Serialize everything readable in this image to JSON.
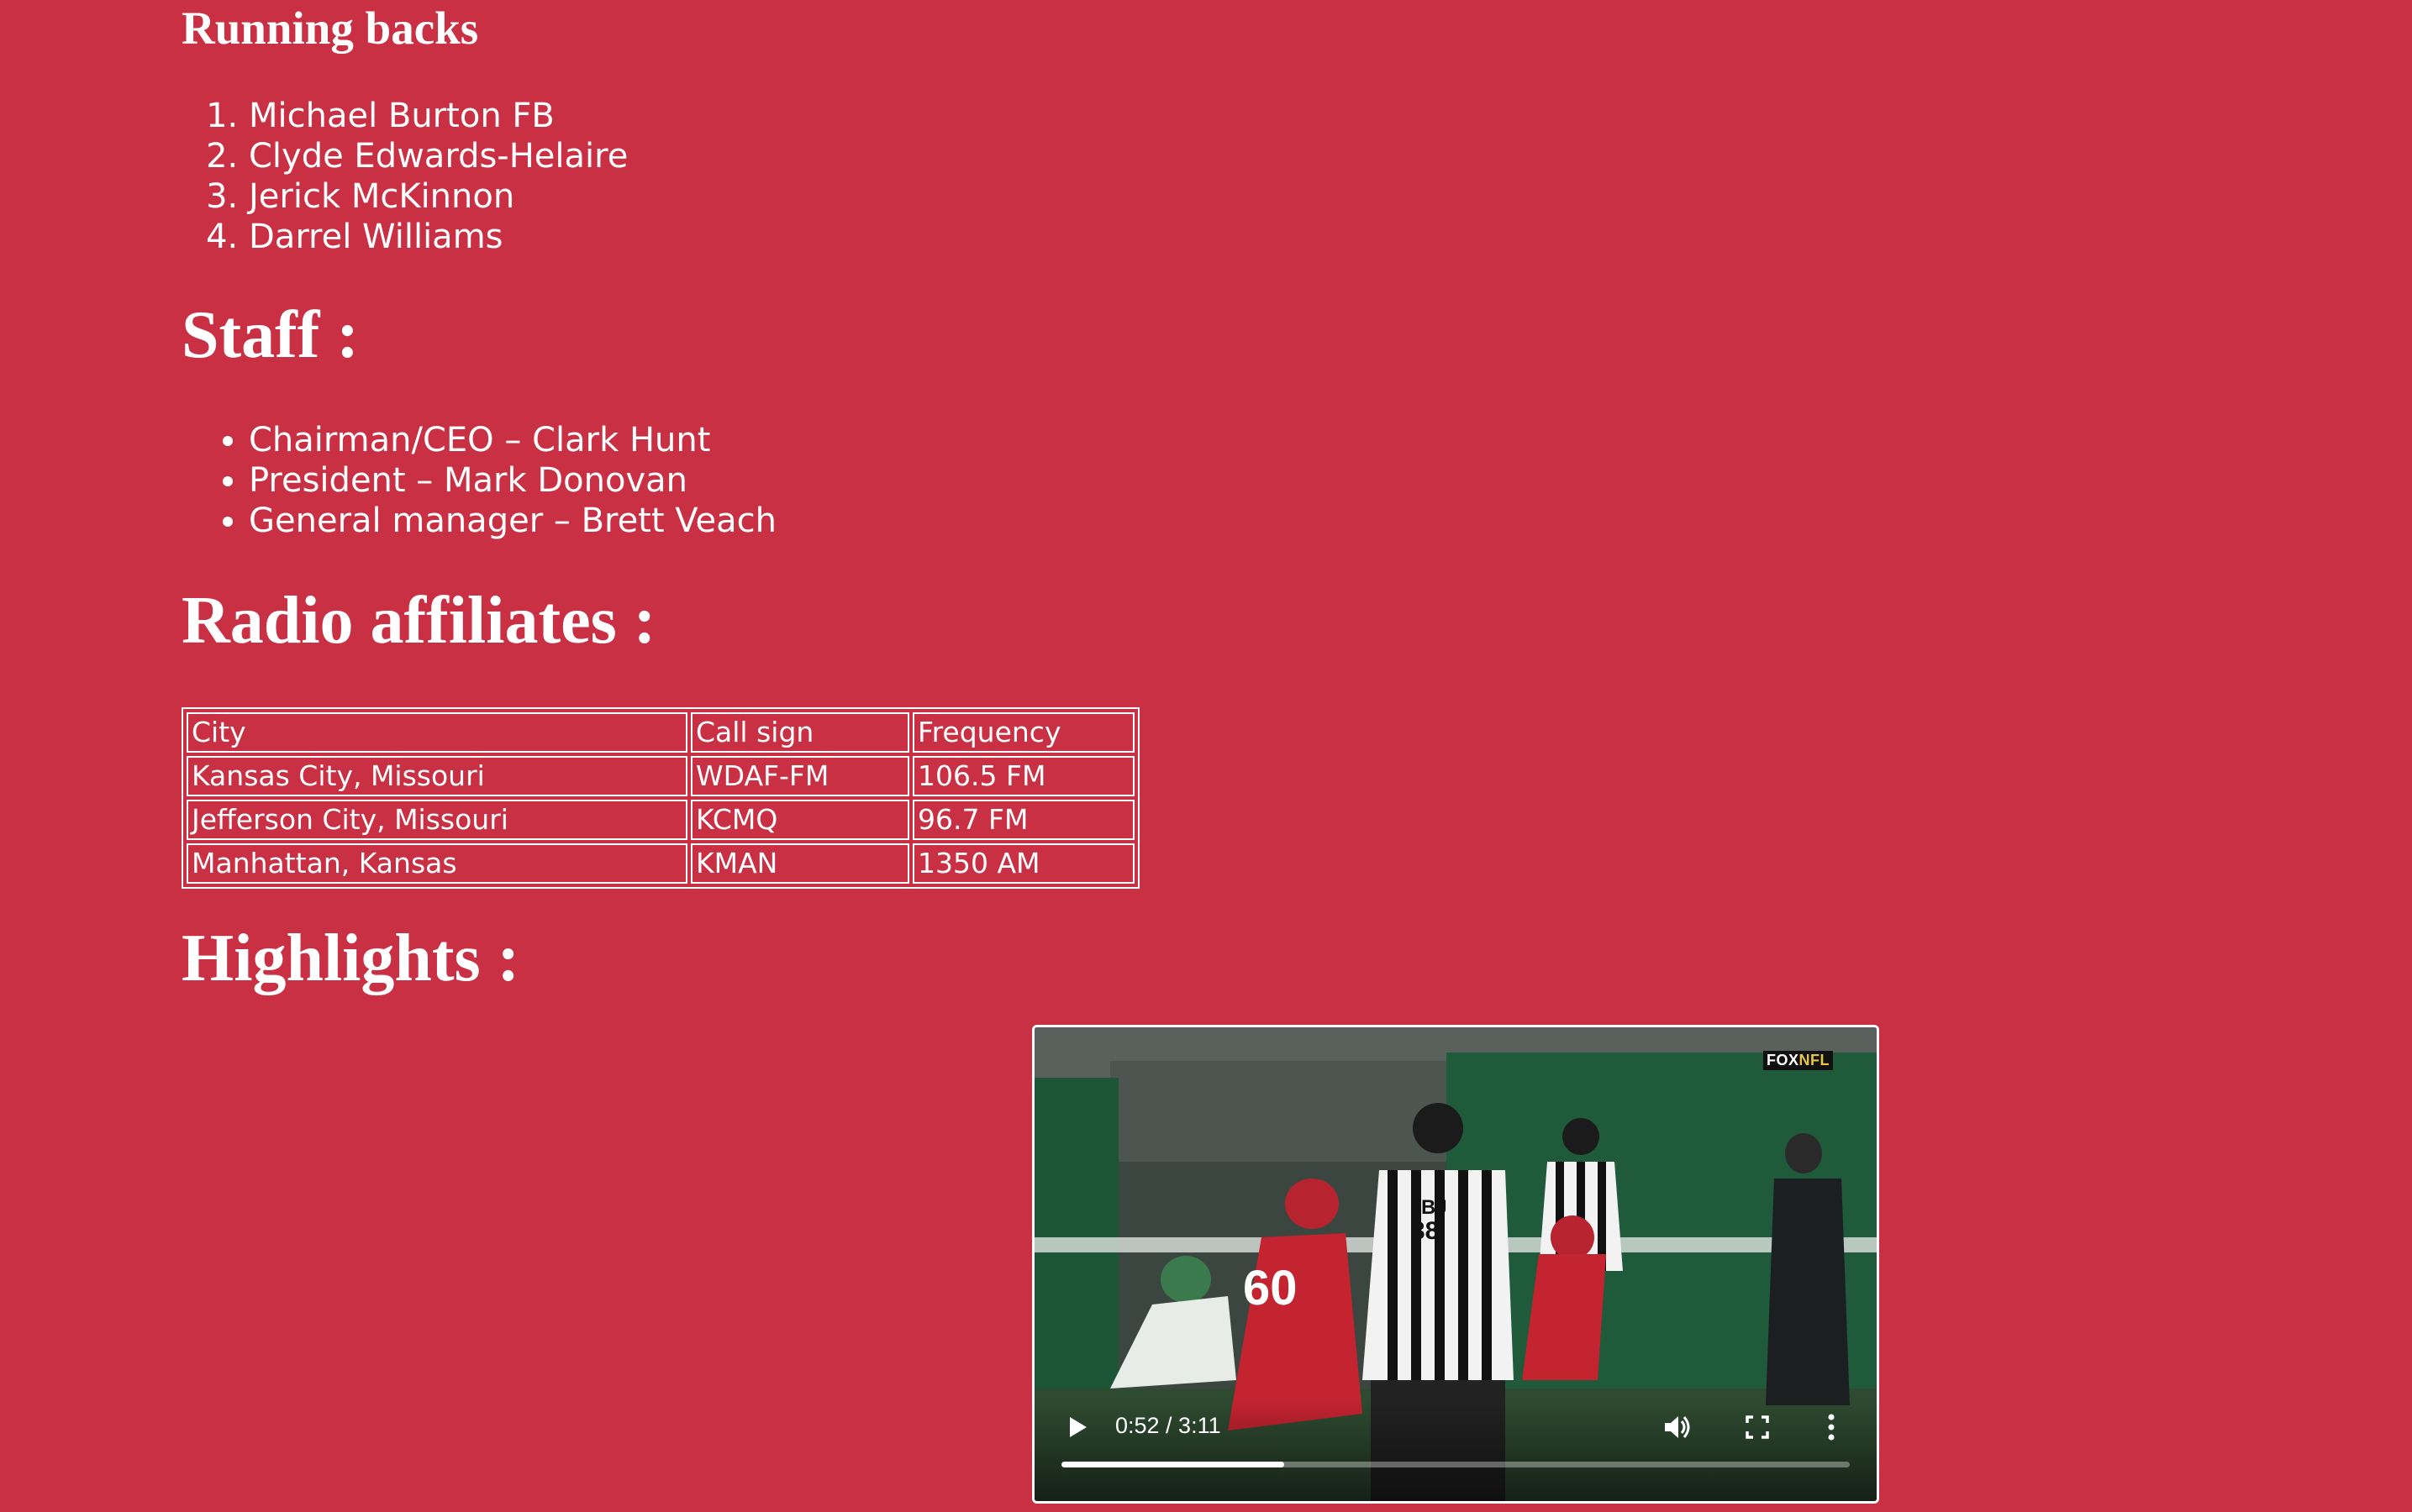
{
  "running_backs": {
    "heading": "Running backs",
    "items": [
      "Michael Burton FB",
      "Clyde Edwards-Helaire",
      "Jerick McKinnon",
      "Darrel Williams"
    ]
  },
  "staff": {
    "heading": "Staff :",
    "items": [
      "Chairman/CEO – Clark Hunt",
      "President – Mark Donovan",
      "General manager – Brett Veach"
    ]
  },
  "radio": {
    "heading": "Radio affiliates :",
    "columns": [
      "City",
      "Call sign",
      "Frequency"
    ],
    "rows": [
      [
        "Kansas City, Missouri",
        "WDAF-FM",
        "106.5 FM"
      ],
      [
        "Jefferson City, Missouri",
        "KCMQ",
        "96.7 FM"
      ],
      [
        "Manhattan, Kansas",
        "KMAN",
        "1350 AM"
      ]
    ]
  },
  "highlights": {
    "heading": "Highlights :",
    "video": {
      "time_display": "0:52 / 3:11",
      "progress_fraction": 0.283,
      "broadcaster_logo": "FOX NFL",
      "jersey_number_1": "60",
      "official_label": "BJ",
      "official_number": "38",
      "icons": [
        "play-icon",
        "volume-icon",
        "fullscreen-icon",
        "more-options-icon"
      ]
    }
  },
  "colors": {
    "background": "#c93043",
    "text": "#ffffff"
  }
}
